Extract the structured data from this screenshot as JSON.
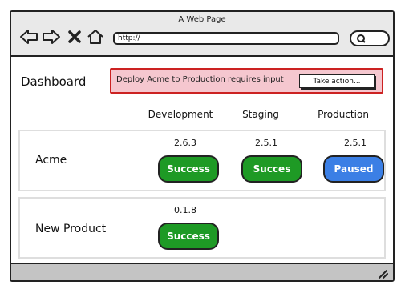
{
  "window": {
    "title": "A Web Page"
  },
  "browser": {
    "url": "http://"
  },
  "icons": {
    "back": "back-arrow-icon",
    "forward": "forward-arrow-icon",
    "close": "close-icon",
    "home": "home-icon",
    "search": "search-icon",
    "resize": "resize-handle-icon"
  },
  "page": {
    "title": "Dashboard"
  },
  "alert": {
    "message": "Deploy Acme to Production requires input",
    "action_label": "Take action..."
  },
  "columns": [
    "Development",
    "Staging",
    "Production"
  ],
  "rows": [
    {
      "name": "Acme",
      "cells": [
        {
          "version": "2.6.3",
          "status": "Success",
          "color": "#1e9a25"
        },
        {
          "version": "2.5.1",
          "status": "Succes",
          "color": "#1e9a25"
        },
        {
          "version": "2.5.1",
          "status": "Paused",
          "color": "#3b7fe5"
        }
      ]
    },
    {
      "name": "New Product",
      "cells": [
        {
          "version": "0.1.8",
          "status": "Success",
          "color": "#1e9a25"
        }
      ]
    }
  ],
  "colors": {
    "success": "#1e9a25",
    "paused": "#3b7fe5",
    "alert_bg": "#f5c7cf",
    "alert_border": "#cc2222"
  }
}
